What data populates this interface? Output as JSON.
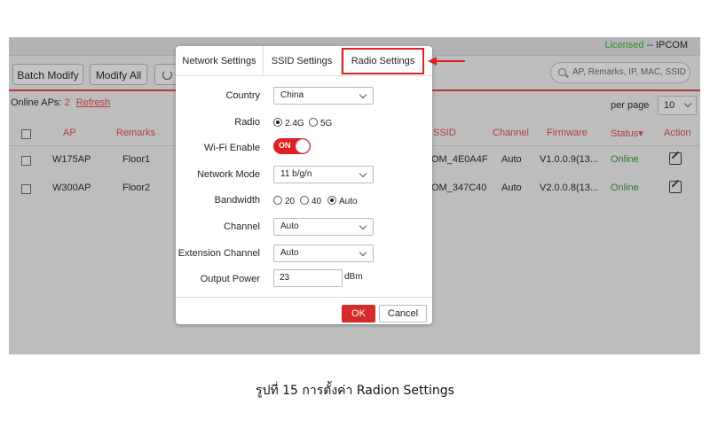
{
  "header": {
    "licensed_label": "Licensed",
    "licensed_sep": " -- ",
    "brand": "IPCOM"
  },
  "toolbar": {
    "batch_modify": "Batch Modify",
    "modify_all": "Modify All",
    "search_placeholder": "AP, Remarks, IP, MAC, SSID"
  },
  "status": {
    "online_label": "Online APs:",
    "online_count": "2",
    "refresh": "Refresh",
    "per_page_label": "per page",
    "per_page_value": "10"
  },
  "table": {
    "columns": [
      "AP",
      "Remarks",
      "SSID",
      "Channel",
      "Firmware",
      "Status▾",
      "Action"
    ],
    "rows": [
      {
        "ap": "W175AP",
        "remarks": "Floor1",
        "ssid": "OM_4E0A4F",
        "channel": "Auto",
        "firmware": "V1.0.0.9(13...",
        "status": "Online"
      },
      {
        "ap": "W300AP",
        "remarks": "Floor2",
        "ssid": "OM_347C40",
        "channel": "Auto",
        "firmware": "V2.0.0.8(13...",
        "status": "Online"
      }
    ]
  },
  "modal": {
    "tabs": [
      "Network Settings",
      "SSID Settings",
      "Radio Settings"
    ],
    "active_tab": "Radio Settings",
    "fields": {
      "country": {
        "label": "Country",
        "value": "China"
      },
      "radio": {
        "label": "Radio",
        "options": [
          "2.4G",
          "5G"
        ],
        "selected": "2.4G"
      },
      "wifi_enable": {
        "label": "Wi-Fi Enable",
        "state": "ON"
      },
      "network_mode": {
        "label": "Network Mode",
        "value": "11 b/g/n"
      },
      "bandwidth": {
        "label": "Bandwidth",
        "options": [
          "20",
          "40",
          "Auto"
        ],
        "selected": "Auto"
      },
      "channel": {
        "label": "Channel",
        "value": "Auto"
      },
      "extension_channel": {
        "label": "Extension Channel",
        "value": "Auto"
      },
      "output_power": {
        "label": "Output Power",
        "value": "23",
        "unit": "dBm"
      }
    },
    "ok": "OK",
    "cancel": "Cancel"
  },
  "caption": "รูปที่ 15 การตั้งค่า Radion Settings",
  "colors": {
    "accent_red": "#e02020",
    "online_green": "#2e7d2e",
    "dimmed_bg": "#bdbdbd"
  },
  "icons": [
    "search-icon",
    "power-icon",
    "chevron-down-icon",
    "edit-icon",
    "arrow-left-icon"
  ]
}
